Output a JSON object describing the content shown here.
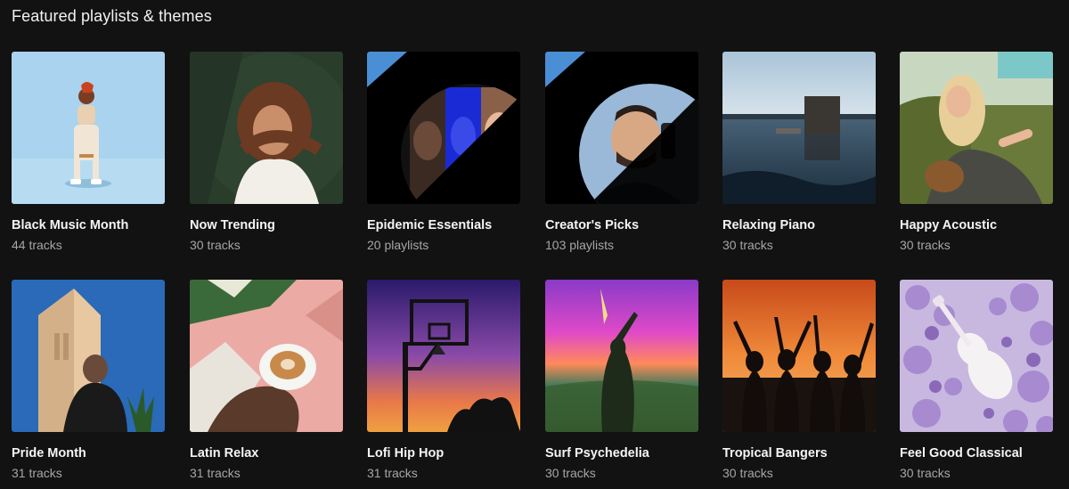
{
  "section": {
    "title": "Featured playlists & themes"
  },
  "playlists": [
    {
      "title": "Black Music Month",
      "subtitle": "44 tracks"
    },
    {
      "title": "Now Trending",
      "subtitle": "30 tracks"
    },
    {
      "title": "Epidemic Essentials",
      "subtitle": "20 playlists"
    },
    {
      "title": "Creator's Picks",
      "subtitle": "103 playlists"
    },
    {
      "title": "Relaxing Piano",
      "subtitle": "30 tracks"
    },
    {
      "title": "Happy Acoustic",
      "subtitle": "30 tracks"
    },
    {
      "title": "Pride Month",
      "subtitle": "31 tracks"
    },
    {
      "title": "Latin Relax",
      "subtitle": "31 tracks"
    },
    {
      "title": "Lofi Hip Hop",
      "subtitle": "31 tracks"
    },
    {
      "title": "Surf Psychedelia",
      "subtitle": "30 tracks"
    },
    {
      "title": "Tropical Bangers",
      "subtitle": "30 tracks"
    },
    {
      "title": "Feel Good Classical",
      "subtitle": "30 tracks"
    }
  ],
  "colors": {
    "background": "#121212",
    "title_text": "#f5f5f5",
    "subtitle_text": "#a6a6a6"
  }
}
